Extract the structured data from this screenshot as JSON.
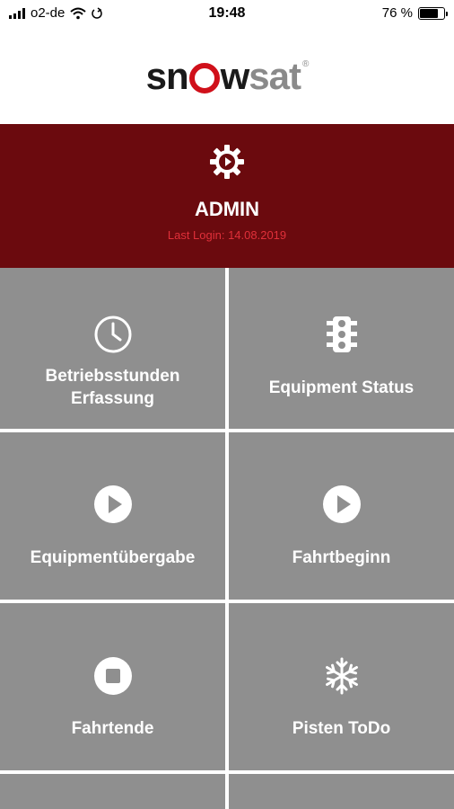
{
  "status_bar": {
    "carrier": "o2-de",
    "time": "19:48",
    "battery_percent": "76 %",
    "battery_level": 0.76
  },
  "logo": {
    "part1": "sn",
    "part2": "w",
    "part3": "sat",
    "mark": "®"
  },
  "admin": {
    "role": "ADMIN",
    "last_login": "Last Login: 14.08.2019",
    "icon": "gear-icon"
  },
  "colors": {
    "banner_bg": "#6b0a0e",
    "tile_bg": "#8f8f8f",
    "logo_accent": "#d0101a"
  },
  "menu": {
    "betriebsstunden_line1": "Betriebsstunden",
    "betriebsstunden_line2": "Erfassung",
    "equipment_status": "Equipment Status",
    "equipmentuebergabe": "Equipmentübergabe",
    "fahrtbeginn": "Fahrtbeginn",
    "fahrtende": "Fahrtende",
    "pisten_todo": "Pisten ToDo"
  }
}
